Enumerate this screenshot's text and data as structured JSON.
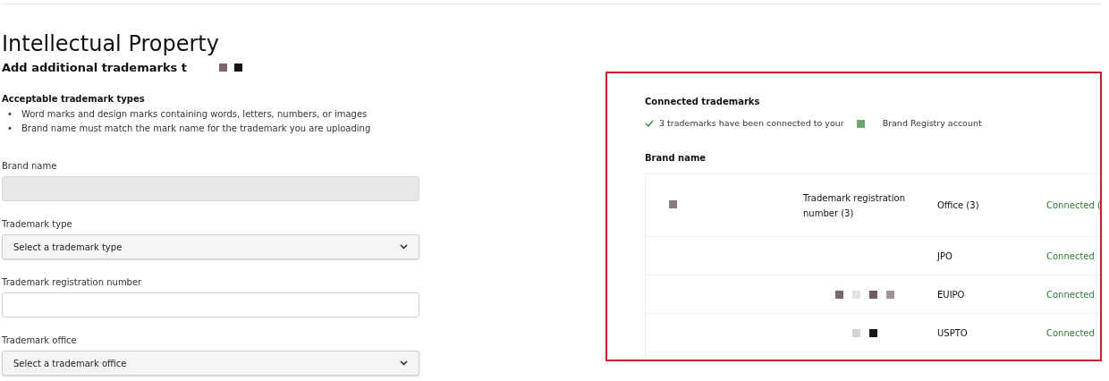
{
  "page": {
    "title": "Intellectual Property",
    "subtitle": "Add additional trademarks t"
  },
  "guidelines": {
    "heading": "Acceptable trademark types",
    "items": [
      {
        "bullet": "•",
        "text": "Word marks and design marks containing words, letters, numbers, or images"
      },
      {
        "bullet": "•",
        "text": "Brand name must match the mark name for the trademark you are uploading"
      }
    ]
  },
  "form": [
    {
      "kind": "text",
      "label": "Brand name",
      "disabled": true
    },
    {
      "kind": "select",
      "label": "Trademark type",
      "placeholder": "Select a trademark type",
      "disabled": false
    },
    {
      "kind": "text",
      "label": "Trademark registration number",
      "disabled": false
    },
    {
      "kind": "select",
      "label": "Trademark office",
      "placeholder": "Select a trademark office",
      "disabled": false
    }
  ],
  "connected": {
    "heading": "Connected trademarks",
    "message_before": "3 trademarks have been connected to your",
    "message_after": "Brand Registry account",
    "brand_heading": "Brand name",
    "table": {
      "columns": [
        "Trademark registration number (3)",
        "Office (3)",
        "Connected ("
      ],
      "rows": [
        {
          "office": "JPO",
          "status": "Connected"
        },
        {
          "office": "EUIPO",
          "status": "Connected"
        },
        {
          "office": "USPTO",
          "status": "Connected"
        }
      ]
    }
  }
}
